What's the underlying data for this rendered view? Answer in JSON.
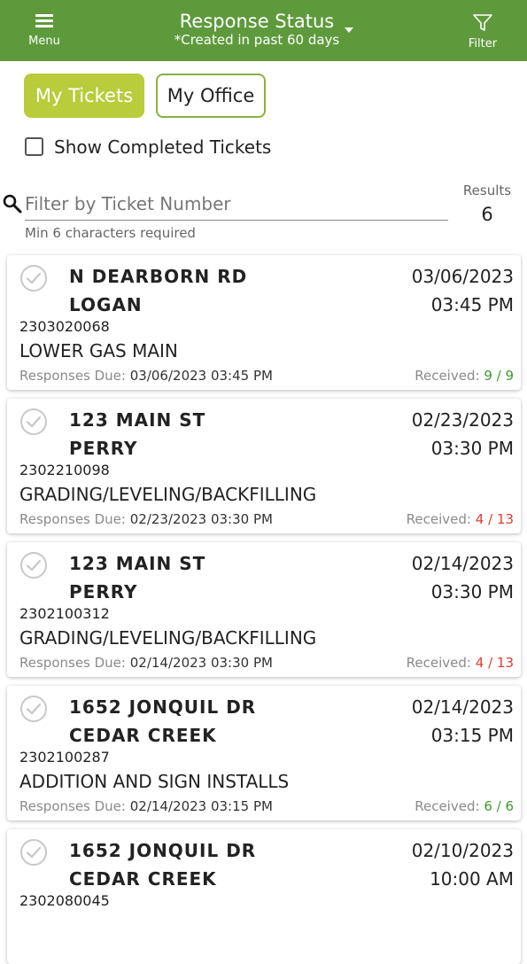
{
  "header": {
    "menu_label": "Menu",
    "title": "Response Status",
    "subtitle": "*Created in past 60 days",
    "filter_label": "Filter",
    "background_color": "#5e9a3c"
  },
  "tabs": [
    {
      "label": "My Tickets",
      "active": true
    },
    {
      "label": "My Office",
      "active": false
    }
  ],
  "show_completed": {
    "label": "Show Completed Tickets",
    "checked": false
  },
  "search": {
    "placeholder": "Filter by Ticket Number",
    "value": "",
    "helper": "Min 6 characters required",
    "results_label": "Results",
    "results_count": "6"
  },
  "labels": {
    "responses_due": "Responses Due:",
    "received": "Received:"
  },
  "colors": {
    "accent": "#b8cc3c",
    "received_complete": "#3e9a2f",
    "received_incomplete": "#e23b2e"
  },
  "tickets": [
    {
      "address": "N DEARBORN RD",
      "city": "LOGAN",
      "date": "03/06/2023",
      "time": "03:45 PM",
      "ticket_number": "2303020068",
      "work_type": "LOWER GAS MAIN",
      "due": "03/06/2023 03:45 PM",
      "received": "9 / 9",
      "status": "ok"
    },
    {
      "address": "123 MAIN ST",
      "city": "PERRY",
      "date": "02/23/2023",
      "time": "03:30 PM",
      "ticket_number": "2302210098",
      "work_type": "GRADING/LEVELING/BACKFILLING",
      "due": "02/23/2023 03:30 PM",
      "received": "4 / 13",
      "status": "bad"
    },
    {
      "address": "123 MAIN ST",
      "city": "PERRY",
      "date": "02/14/2023",
      "time": "03:30 PM",
      "ticket_number": "2302100312",
      "work_type": "GRADING/LEVELING/BACKFILLING",
      "due": "02/14/2023 03:30 PM",
      "received": "4 / 13",
      "status": "bad"
    },
    {
      "address": "1652 JONQUIL DR",
      "city": "CEDAR CREEK",
      "date": "02/14/2023",
      "time": "03:15 PM",
      "ticket_number": "2302100287",
      "work_type": "ADDITION AND SIGN INSTALLS",
      "due": "02/14/2023 03:15 PM",
      "received": "6 / 6",
      "status": "ok"
    },
    {
      "address": "1652 JONQUIL DR",
      "city": "CEDAR CREEK",
      "date": "02/10/2023",
      "time": "10:00 AM",
      "ticket_number": "2302080045",
      "work_type": "",
      "due": "",
      "received": "",
      "status": "ok"
    }
  ]
}
